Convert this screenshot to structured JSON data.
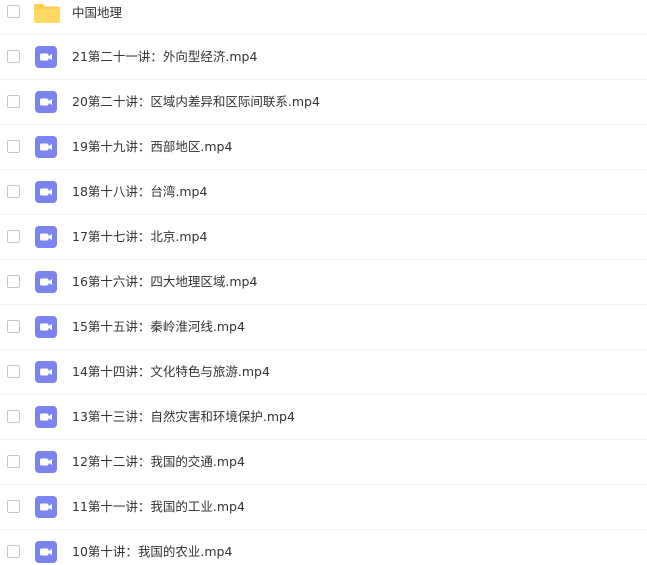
{
  "colors": {
    "folder": "#ffcf4f",
    "video_icon": "#7b83ee",
    "border": "#eef0f3"
  },
  "folder": {
    "icon": "folder-icon",
    "name": "中国地理"
  },
  "files": [
    {
      "icon": "video-file-icon",
      "name": "21第二十一讲：外向型经济.mp4"
    },
    {
      "icon": "video-file-icon",
      "name": "20第二十讲：区域内差异和区际间联系.mp4"
    },
    {
      "icon": "video-file-icon",
      "name": "19第十九讲：西部地区.mp4"
    },
    {
      "icon": "video-file-icon",
      "name": "18第十八讲：台湾.mp4"
    },
    {
      "icon": "video-file-icon",
      "name": "17第十七讲：北京.mp4"
    },
    {
      "icon": "video-file-icon",
      "name": "16第十六讲：四大地理区域.mp4"
    },
    {
      "icon": "video-file-icon",
      "name": "15第十五讲：秦岭淮河线.mp4"
    },
    {
      "icon": "video-file-icon",
      "name": "14第十四讲：文化特色与旅游.mp4"
    },
    {
      "icon": "video-file-icon",
      "name": "13第十三讲：自然灾害和环境保护.mp4"
    },
    {
      "icon": "video-file-icon",
      "name": "12第十二讲：我国的交通.mp4"
    },
    {
      "icon": "video-file-icon",
      "name": "11第十一讲：我国的工业.mp4"
    },
    {
      "icon": "video-file-icon",
      "name": "10第十讲：我国的农业.mp4"
    }
  ]
}
